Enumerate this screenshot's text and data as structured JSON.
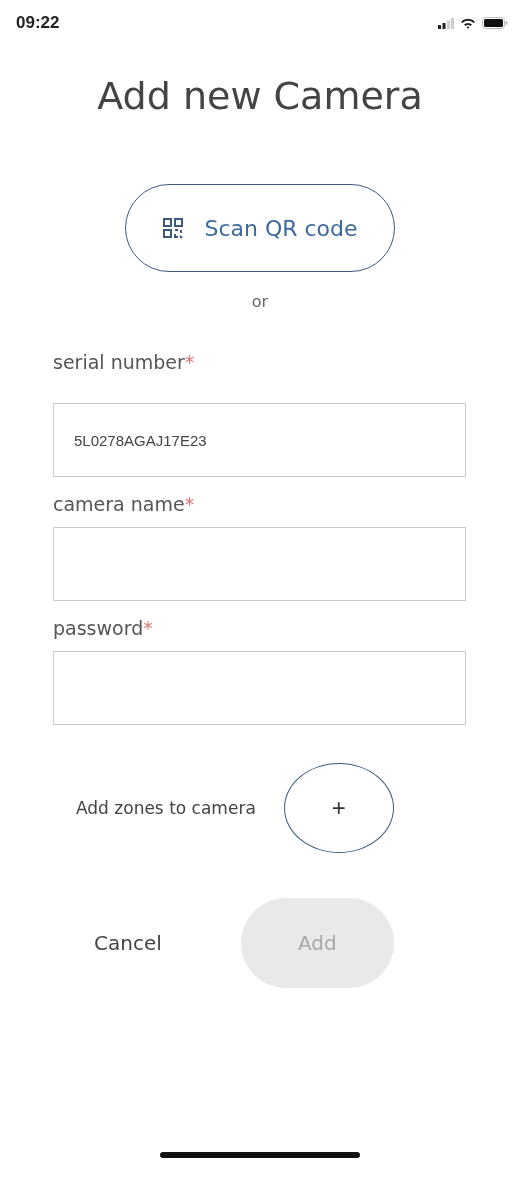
{
  "status_bar": {
    "time": "09:22"
  },
  "title": "Add new Camera",
  "scan_button": {
    "label": "Scan QR code"
  },
  "separator": "or",
  "fields": [
    {
      "label": "serial number",
      "required_mark": "*",
      "value": "5L0278AGAJ17E23"
    },
    {
      "label": "camera name",
      "required_mark": "*"
    },
    {
      "label": "password",
      "required_mark": "*"
    }
  ],
  "zones": {
    "label": "Add zones to camera",
    "button": "+"
  },
  "actions": {
    "cancel": "Cancel",
    "add": {
      "label": "Add",
      "disabled": true
    }
  }
}
